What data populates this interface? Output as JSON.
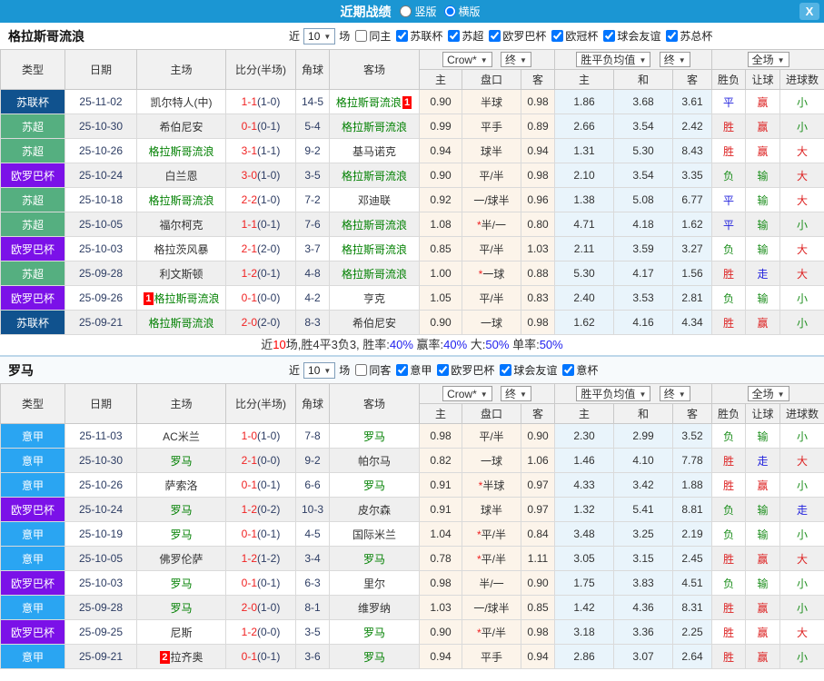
{
  "titlebar": {
    "title": "近期战绩",
    "vertical": "竖版",
    "horizontal": "横版",
    "vertical_selected": false,
    "horizontal_selected": true,
    "close": "X"
  },
  "header": {
    "type": "类型",
    "date": "日期",
    "home": "主场",
    "score": "比分(半场)",
    "corner": "角球",
    "away": "客场",
    "odds_home": "主",
    "odds_hcap": "盘口",
    "odds_away": "客",
    "avg_win": "主",
    "avg_draw": "和",
    "avg_lose": "客",
    "res_wdl": "胜负",
    "res_hcap": "让球",
    "res_goals": "进球数"
  },
  "colors": {
    "league": {
      "苏联杯": "#10528e",
      "苏超": "#55af80",
      "欧罗巴杯": "#7b11e8",
      "意甲": "#2aa5f2"
    },
    "result": {
      "胜": "#dd2222",
      "负": "#1e8f1e",
      "平": "#2222dd",
      "赢": "#dd2222",
      "输": "#1e8f1e",
      "走": "#2222dd",
      "大": "#dd2222",
      "小": "#1e8f1e"
    },
    "summary": {
      "dark": "#333333",
      "red": "#ff0000",
      "blue": "#2222ee"
    }
  },
  "sections": [
    {
      "team": "格拉斯哥流浪",
      "filter": {
        "near": "近",
        "games": "10",
        "unit": "场",
        "same": "同主",
        "leagues": [
          "苏联杯",
          "苏超",
          "欧罗巴杯",
          "欧冠杯",
          "球会友谊",
          "苏总杯"
        ]
      },
      "dropdowns": {
        "book": "Crow*",
        "final1": "终",
        "avg": "胜平负均值",
        "final2": "终",
        "scope": "全场"
      },
      "rows": [
        {
          "league": "苏联杯",
          "date": "25-11-02",
          "home": "凯尔特人(中)",
          "home_self": false,
          "home_badge": "",
          "score": "1-1",
          "half": "(1-0)",
          "corner": "14-5",
          "away": "格拉斯哥流浪",
          "away_self": true,
          "away_badge": "1",
          "o1": "0.90",
          "hcap": "半球",
          "o2": "0.98",
          "avg_w": "1.86",
          "avg_d": "3.68",
          "avg_l": "3.61",
          "r_wdl": "平",
          "r_hcap": "赢",
          "r_goal": "小"
        },
        {
          "league": "苏超",
          "date": "25-10-30",
          "home": "希伯尼安",
          "home_self": false,
          "home_badge": "",
          "score": "0-1",
          "half": "(0-1)",
          "corner": "5-4",
          "away": "格拉斯哥流浪",
          "away_self": true,
          "away_badge": "",
          "o1": "0.99",
          "hcap": "平手",
          "o2": "0.89",
          "avg_w": "2.66",
          "avg_d": "3.54",
          "avg_l": "2.42",
          "r_wdl": "胜",
          "r_hcap": "赢",
          "r_goal": "小"
        },
        {
          "league": "苏超",
          "date": "25-10-26",
          "home": "格拉斯哥流浪",
          "home_self": true,
          "home_badge": "",
          "score": "3-1",
          "half": "(1-1)",
          "corner": "9-2",
          "away": "基马诺克",
          "away_self": false,
          "away_badge": "",
          "o1": "0.94",
          "hcap": "球半",
          "o2": "0.94",
          "avg_w": "1.31",
          "avg_d": "5.30",
          "avg_l": "8.43",
          "r_wdl": "胜",
          "r_hcap": "赢",
          "r_goal": "大"
        },
        {
          "league": "欧罗巴杯",
          "date": "25-10-24",
          "home": "白兰恩",
          "home_self": false,
          "home_badge": "",
          "score": "3-0",
          "half": "(1-0)",
          "corner": "3-5",
          "away": "格拉斯哥流浪",
          "away_self": true,
          "away_badge": "",
          "o1": "0.90",
          "hcap": "平/半",
          "o2": "0.98",
          "avg_w": "2.10",
          "avg_d": "3.54",
          "avg_l": "3.35",
          "r_wdl": "负",
          "r_hcap": "输",
          "r_goal": "大"
        },
        {
          "league": "苏超",
          "date": "25-10-18",
          "home": "格拉斯哥流浪",
          "home_self": true,
          "home_badge": "",
          "score": "2-2",
          "half": "(1-0)",
          "corner": "7-2",
          "away": "邓迪联",
          "away_self": false,
          "away_badge": "",
          "o1": "0.92",
          "hcap": "一/球半",
          "o2": "0.96",
          "avg_w": "1.38",
          "avg_d": "5.08",
          "avg_l": "6.77",
          "r_wdl": "平",
          "r_hcap": "输",
          "r_goal": "大"
        },
        {
          "league": "苏超",
          "date": "25-10-05",
          "home": "福尔柯克",
          "home_self": false,
          "home_badge": "",
          "score": "1-1",
          "half": "(0-1)",
          "corner": "7-6",
          "away": "格拉斯哥流浪",
          "away_self": true,
          "away_badge": "",
          "o1": "1.08",
          "hcap": "*半/一",
          "o2": "0.80",
          "avg_w": "4.71",
          "avg_d": "4.18",
          "avg_l": "1.62",
          "r_wdl": "平",
          "r_hcap": "输",
          "r_goal": "小"
        },
        {
          "league": "欧罗巴杯",
          "date": "25-10-03",
          "home": "格拉茨风暴",
          "home_self": false,
          "home_badge": "",
          "score": "2-1",
          "half": "(2-0)",
          "corner": "3-7",
          "away": "格拉斯哥流浪",
          "away_self": true,
          "away_badge": "",
          "o1": "0.85",
          "hcap": "平/半",
          "o2": "1.03",
          "avg_w": "2.11",
          "avg_d": "3.59",
          "avg_l": "3.27",
          "r_wdl": "负",
          "r_hcap": "输",
          "r_goal": "大"
        },
        {
          "league": "苏超",
          "date": "25-09-28",
          "home": "利文斯顿",
          "home_self": false,
          "home_badge": "",
          "score": "1-2",
          "half": "(0-1)",
          "corner": "4-8",
          "away": "格拉斯哥流浪",
          "away_self": true,
          "away_badge": "",
          "o1": "1.00",
          "hcap": "*一球",
          "o2": "0.88",
          "avg_w": "5.30",
          "avg_d": "4.17",
          "avg_l": "1.56",
          "r_wdl": "胜",
          "r_hcap": "走",
          "r_goal": "大"
        },
        {
          "league": "欧罗巴杯",
          "date": "25-09-26",
          "home": "格拉斯哥流浪",
          "home_self": true,
          "home_badge": "1",
          "score": "0-1",
          "half": "(0-0)",
          "corner": "4-2",
          "away": "亨克",
          "away_self": false,
          "away_badge": "",
          "o1": "1.05",
          "hcap": "平/半",
          "o2": "0.83",
          "avg_w": "2.40",
          "avg_d": "3.53",
          "avg_l": "2.81",
          "r_wdl": "负",
          "r_hcap": "输",
          "r_goal": "小"
        },
        {
          "league": "苏联杯",
          "date": "25-09-21",
          "home": "格拉斯哥流浪",
          "home_self": true,
          "home_badge": "",
          "score": "2-0",
          "half": "(2-0)",
          "corner": "8-3",
          "away": "希伯尼安",
          "away_self": false,
          "away_badge": "",
          "o1": "0.90",
          "hcap": "一球",
          "o2": "0.98",
          "avg_w": "1.62",
          "avg_d": "4.16",
          "avg_l": "4.34",
          "r_wdl": "胜",
          "r_hcap": "赢",
          "r_goal": "小"
        }
      ],
      "summary": [
        [
          "近",
          "dark"
        ],
        [
          "10",
          "red"
        ],
        [
          "场,胜4平3负3, 胜率:",
          "dark"
        ],
        [
          "40%",
          "blue"
        ],
        [
          " 赢率:",
          "dark"
        ],
        [
          "40%",
          "blue"
        ],
        [
          " 大:",
          "dark"
        ],
        [
          "50%",
          "blue"
        ],
        [
          " 单率:",
          "dark"
        ],
        [
          "50%",
          "blue"
        ]
      ]
    },
    {
      "team": "罗马",
      "filter": {
        "near": "近",
        "games": "10",
        "unit": "场",
        "same": "同客",
        "leagues": [
          "意甲",
          "欧罗巴杯",
          "球会友谊",
          "意杯"
        ]
      },
      "dropdowns": {
        "book": "Crow*",
        "final1": "终",
        "avg": "胜平负均值",
        "final2": "终",
        "scope": "全场"
      },
      "rows": [
        {
          "league": "意甲",
          "date": "25-11-03",
          "home": "AC米兰",
          "home_self": false,
          "home_badge": "",
          "score": "1-0",
          "half": "(1-0)",
          "corner": "7-8",
          "away": "罗马",
          "away_self": true,
          "away_badge": "",
          "o1": "0.98",
          "hcap": "平/半",
          "o2": "0.90",
          "avg_w": "2.30",
          "avg_d": "2.99",
          "avg_l": "3.52",
          "r_wdl": "负",
          "r_hcap": "输",
          "r_goal": "小"
        },
        {
          "league": "意甲",
          "date": "25-10-30",
          "home": "罗马",
          "home_self": true,
          "home_badge": "",
          "score": "2-1",
          "half": "(0-0)",
          "corner": "9-2",
          "away": "帕尔马",
          "away_self": false,
          "away_badge": "",
          "o1": "0.82",
          "hcap": "一球",
          "o2": "1.06",
          "avg_w": "1.46",
          "avg_d": "4.10",
          "avg_l": "7.78",
          "r_wdl": "胜",
          "r_hcap": "走",
          "r_goal": "大"
        },
        {
          "league": "意甲",
          "date": "25-10-26",
          "home": "萨索洛",
          "home_self": false,
          "home_badge": "",
          "score": "0-1",
          "half": "(0-1)",
          "corner": "6-6",
          "away": "罗马",
          "away_self": true,
          "away_badge": "",
          "o1": "0.91",
          "hcap": "*半球",
          "o2": "0.97",
          "avg_w": "4.33",
          "avg_d": "3.42",
          "avg_l": "1.88",
          "r_wdl": "胜",
          "r_hcap": "赢",
          "r_goal": "小"
        },
        {
          "league": "欧罗巴杯",
          "date": "25-10-24",
          "home": "罗马",
          "home_self": true,
          "home_badge": "",
          "score": "1-2",
          "half": "(0-2)",
          "corner": "10-3",
          "away": "皮尔森",
          "away_self": false,
          "away_badge": "",
          "o1": "0.91",
          "hcap": "球半",
          "o2": "0.97",
          "avg_w": "1.32",
          "avg_d": "5.41",
          "avg_l": "8.81",
          "r_wdl": "负",
          "r_hcap": "输",
          "r_goal": "走"
        },
        {
          "league": "意甲",
          "date": "25-10-19",
          "home": "罗马",
          "home_self": true,
          "home_badge": "",
          "score": "0-1",
          "half": "(0-1)",
          "corner": "4-5",
          "away": "国际米兰",
          "away_self": false,
          "away_badge": "",
          "o1": "1.04",
          "hcap": "*平/半",
          "o2": "0.84",
          "avg_w": "3.48",
          "avg_d": "3.25",
          "avg_l": "2.19",
          "r_wdl": "负",
          "r_hcap": "输",
          "r_goal": "小"
        },
        {
          "league": "意甲",
          "date": "25-10-05",
          "home": "佛罗伦萨",
          "home_self": false,
          "home_badge": "",
          "score": "1-2",
          "half": "(1-2)",
          "corner": "3-4",
          "away": "罗马",
          "away_self": true,
          "away_badge": "",
          "o1": "0.78",
          "hcap": "*平/半",
          "o2": "1.11",
          "avg_w": "3.05",
          "avg_d": "3.15",
          "avg_l": "2.45",
          "r_wdl": "胜",
          "r_hcap": "赢",
          "r_goal": "大"
        },
        {
          "league": "欧罗巴杯",
          "date": "25-10-03",
          "home": "罗马",
          "home_self": true,
          "home_badge": "",
          "score": "0-1",
          "half": "(0-1)",
          "corner": "6-3",
          "away": "里尔",
          "away_self": false,
          "away_badge": "",
          "o1": "0.98",
          "hcap": "半/一",
          "o2": "0.90",
          "avg_w": "1.75",
          "avg_d": "3.83",
          "avg_l": "4.51",
          "r_wdl": "负",
          "r_hcap": "输",
          "r_goal": "小"
        },
        {
          "league": "意甲",
          "date": "25-09-28",
          "home": "罗马",
          "home_self": true,
          "home_badge": "",
          "score": "2-0",
          "half": "(1-0)",
          "corner": "8-1",
          "away": "维罗纳",
          "away_self": false,
          "away_badge": "",
          "o1": "1.03",
          "hcap": "一/球半",
          "o2": "0.85",
          "avg_w": "1.42",
          "avg_d": "4.36",
          "avg_l": "8.31",
          "r_wdl": "胜",
          "r_hcap": "赢",
          "r_goal": "小"
        },
        {
          "league": "欧罗巴杯",
          "date": "25-09-25",
          "home": "尼斯",
          "home_self": false,
          "home_badge": "",
          "score": "1-2",
          "half": "(0-0)",
          "corner": "3-5",
          "away": "罗马",
          "away_self": true,
          "away_badge": "",
          "o1": "0.90",
          "hcap": "*平/半",
          "o2": "0.98",
          "avg_w": "3.18",
          "avg_d": "3.36",
          "avg_l": "2.25",
          "r_wdl": "胜",
          "r_hcap": "赢",
          "r_goal": "大"
        },
        {
          "league": "意甲",
          "date": "25-09-21",
          "home": "拉齐奥",
          "home_self": false,
          "home_badge": "2",
          "score": "0-1",
          "half": "(0-1)",
          "corner": "3-6",
          "away": "罗马",
          "away_self": true,
          "away_badge": "",
          "o1": "0.94",
          "hcap": "平手",
          "o2": "0.94",
          "avg_w": "2.86",
          "avg_d": "3.07",
          "avg_l": "2.64",
          "r_wdl": "胜",
          "r_hcap": "赢",
          "r_goal": "小"
        }
      ],
      "summary": null
    }
  ]
}
